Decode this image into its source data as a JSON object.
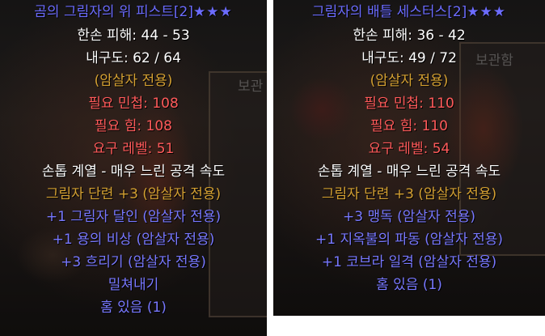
{
  "left_item": {
    "title": "곰의 그림자의 위 피스트[2]",
    "stars": "★★★",
    "storage_label": "보관",
    "lines": [
      {
        "text": "한손 피해: 44 - 53",
        "color": "white"
      },
      {
        "text": "내구도: 62 / 64",
        "color": "white"
      },
      {
        "text": "(암살자 전용)",
        "color": "orange"
      },
      {
        "text": "필요 민첩: 108",
        "color": "red"
      },
      {
        "text": "필요 힘: 108",
        "color": "red"
      },
      {
        "text": "요구 레벨: 51",
        "color": "red"
      },
      {
        "text": "손톱 계열 - 매우 느린 공격 속도",
        "color": "white"
      },
      {
        "text": "그림자 단련 +3 (암살자 전용)",
        "color": "orange"
      },
      {
        "text": "+1 그림자 달인 (암살자 전용)",
        "color": "blue"
      },
      {
        "text": "+1 용의 비상 (암살자 전용)",
        "color": "blue"
      },
      {
        "text": "+3 흐리기 (암살자 전용)",
        "color": "blue"
      },
      {
        "text": "밀쳐내기",
        "color": "blue"
      },
      {
        "text": "홈 있음 (1)",
        "color": "blue"
      }
    ]
  },
  "right_item": {
    "title": "그림자의 배틀 세스터스[2]",
    "stars": "★★★",
    "storage_label": "보관함",
    "lines": [
      {
        "text": "한손 피해: 36 - 42",
        "color": "white"
      },
      {
        "text": "내구도: 49 / 72",
        "color": "white"
      },
      {
        "text": "(암살자 전용)",
        "color": "orange"
      },
      {
        "text": "필요 민첩: 110",
        "color": "red"
      },
      {
        "text": "필요 힘: 110",
        "color": "red"
      },
      {
        "text": "요구 레벨: 54",
        "color": "red"
      },
      {
        "text": "손톱 계열 - 매우 느린 공격 속도",
        "color": "white"
      },
      {
        "text": "그림자 단련 +3 (암살자 전용)",
        "color": "orange"
      },
      {
        "text": "+3 맹독 (암살자 전용)",
        "color": "blue"
      },
      {
        "text": "+1 지옥불의 파동 (암살자 전용)",
        "color": "blue"
      },
      {
        "text": "+1 코브라 일격 (암살자 전용)",
        "color": "blue"
      },
      {
        "text": "홈 있음 (1)",
        "color": "blue"
      }
    ]
  },
  "colors": {
    "title": "#6c6cff",
    "white": "#ffffff",
    "orange": "#d4a032",
    "red": "#ff5a5a",
    "blue": "#7878ff"
  }
}
